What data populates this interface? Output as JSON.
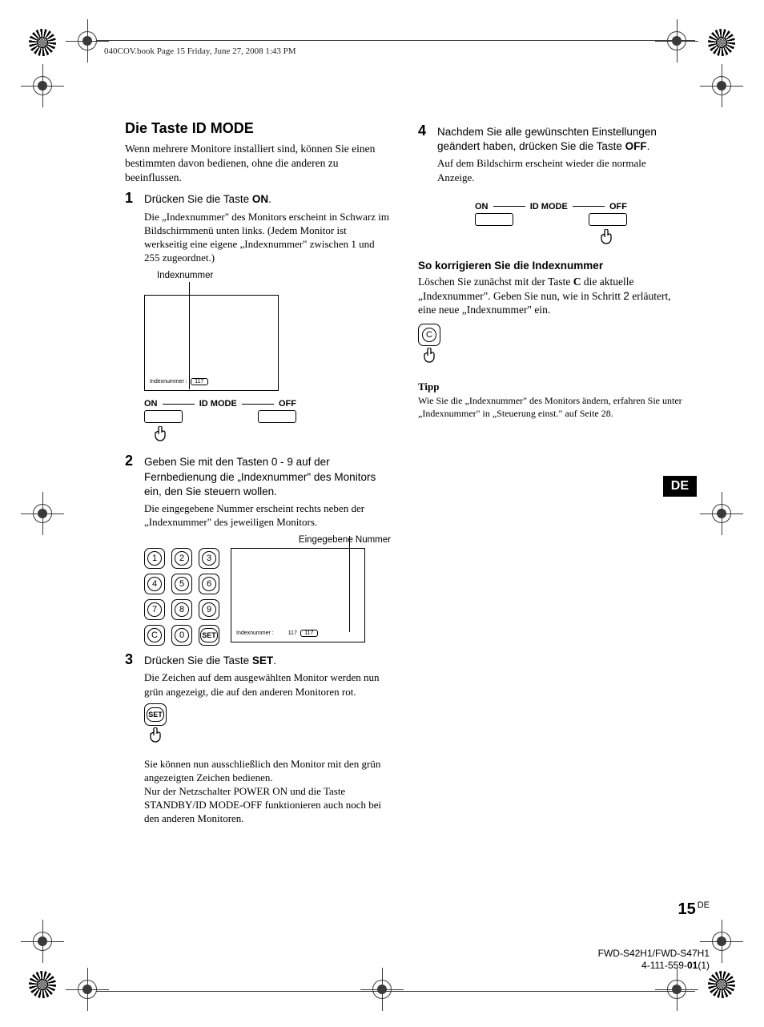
{
  "header_text": "040COV.book  Page 15  Friday, June 27, 2008  1:43 PM",
  "section_title": "Die Taste ID MODE",
  "intro": "Wenn mehrere Monitore installiert sind, können Sie einen bestimmten davon bedienen, ohne die anderen zu beeinflussen.",
  "steps": {
    "1": {
      "lead_pre": "Drücken Sie die Taste ",
      "lead_bold": "ON",
      "lead_post": ".",
      "body": "Die „Indexnummer\" des Monitors erscheint in Schwarz im Bildschirmmenü unten links. (Jedem Monitor ist werkseitig eine eigene „Indexnummer\" zwischen 1 und 255 zugeordnet.)"
    },
    "2": {
      "lead": "Geben Sie mit den Tasten 0 - 9 auf der Fernbedienung die „Indexnummer\" des Monitors ein, den Sie steuern wollen.",
      "body": "Die eingegebene Nummer erscheint rechts neben der „Indexnummer\" des jeweiligen Monitors."
    },
    "3": {
      "lead_pre": "Drücken Sie die Taste ",
      "lead_bold": "SET",
      "lead_post": ".",
      "body1": "Die Zeichen auf dem ausgewählten Monitor werden nun grün angezeigt, die auf den anderen Monitoren rot.",
      "body2": "Sie können nun ausschließlich den Monitor mit den grün angezeigten Zeichen bedienen.\nNur der Netzschalter POWER ON und die Taste STANDBY/ID MODE-OFF funktionieren auch noch bei den anderen Monitoren."
    },
    "4": {
      "lead_pre": "Nachdem Sie alle gewünschten Einstellungen geändert haben, drücken Sie die Taste ",
      "lead_bold": "OFF",
      "lead_post": ".",
      "body": "Auf dem Bildschirm erscheint wieder die normale Anzeige."
    }
  },
  "caption_indexnummer": "Indexnummer",
  "caption_eingegebene": "Eingegebene Nummer",
  "screen_label": "Indexnummer :",
  "screen_value": "117",
  "idmode": {
    "on": "ON",
    "mid": "ID MODE",
    "off": "OFF"
  },
  "keypad": [
    "1",
    "2",
    "3",
    "4",
    "5",
    "6",
    "7",
    "8",
    "9",
    "C",
    "0",
    "SET"
  ],
  "sub_heading": "So korrigieren Sie die Indexnummer",
  "sub_body_1": "Löschen Sie zunächst mit der Taste ",
  "sub_body_bold": "C",
  "sub_body_2": " die aktuelle „Indexnummer\". Geben Sie nun, wie in Schritt ",
  "sub_body_step": "2",
  "sub_body_3": " erläutert, eine neue „Indexnummer\" ein.",
  "tipp_heading": "Tipp",
  "tipp_body": "Wie Sie die „Indexnummer\" des Monitors ändern, erfahren Sie unter „Indexnummer\" in „Steuerung einst.\" auf Seite 28.",
  "lang_tab": "DE",
  "page_number": "15",
  "page_lang": "DE",
  "model_line1": "FWD-S42H1/FWD-S47H1",
  "model_line2_pre": "4-111-559-",
  "model_line2_bold": "01",
  "model_line2_post": "(1)"
}
